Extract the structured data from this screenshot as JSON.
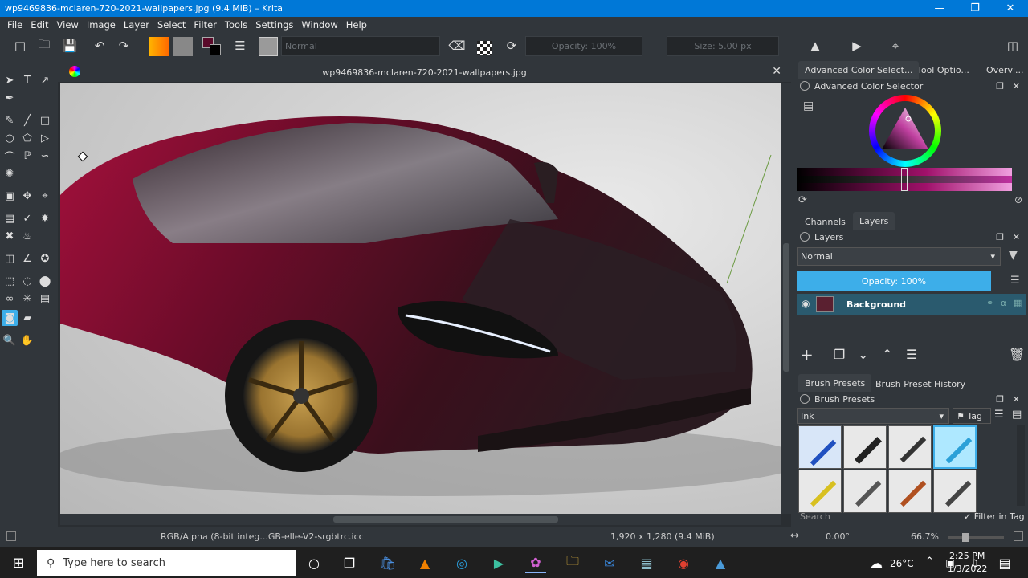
{
  "window": {
    "title": "wp9469836-mclaren-720-2021-wallpapers.jpg (9.4 MiB)  –  Krita"
  },
  "menu": [
    "File",
    "Edit",
    "View",
    "Image",
    "Layer",
    "Select",
    "Filter",
    "Tools",
    "Settings",
    "Window",
    "Help"
  ],
  "toolbar": {
    "blend_mode": "Normal",
    "opacity": "Opacity: 100%",
    "size": "Size: 5.00 px"
  },
  "document": {
    "title": "wp9469836-mclaren-720-2021-wallpapers.jpg"
  },
  "status": {
    "color_profile": "RGB/Alpha (8-bit integ...GB-elle-V2-srgbtrc.icc",
    "dimensions": "1,920 x 1,280 (9.4 MiB)",
    "rotation": "0.00°",
    "zoom": "66.7%"
  },
  "dock": {
    "top_tabs": [
      "Advanced Color Select...",
      "Tool Optio...",
      "Overvi..."
    ],
    "color_selector_title": "Advanced Color Selector",
    "layer_tabs": [
      "Channels",
      "Layers"
    ],
    "layers_title": "Layers",
    "layer_blend": "Normal",
    "layer_opacity": "Opacity:  100%",
    "layers": [
      {
        "name": "Background"
      }
    ],
    "brush_tabs": [
      "Brush Presets",
      "Brush Preset History"
    ],
    "brush_title": "Brush Presets",
    "brush_tag": "Ink",
    "tag_button": "Tag",
    "search_placeholder": "Search",
    "filter_in_tag": "Filter in Tag"
  },
  "taskbar": {
    "search_placeholder": "Type here to search",
    "weather": "26°C",
    "time": "2:25 PM",
    "date": "1/3/2022"
  },
  "colors": {
    "accent": "#0078d7",
    "selection": "#3daee9",
    "car": "#7a0f2e"
  }
}
